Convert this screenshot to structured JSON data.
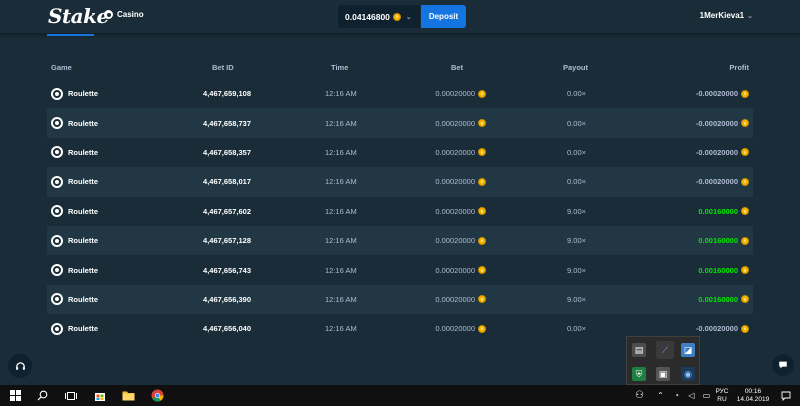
{
  "header": {
    "logo": "Stake",
    "nav_casino": "Casino",
    "balance": "0.04146800",
    "deposit_label": "Deposit",
    "username": "1MerKieva1"
  },
  "table": {
    "headers": {
      "game": "Game",
      "bet_id": "Bet ID",
      "time": "Time",
      "bet": "Bet",
      "payout": "Payout",
      "profit": "Profit"
    },
    "rows": [
      {
        "game": "Roulette",
        "bet_id": "4,467,659,108",
        "time": "12:16 AM",
        "bet": "0.00020000",
        "payout": "0.00×",
        "profit": "-0.00020000",
        "win": false
      },
      {
        "game": "Roulette",
        "bet_id": "4,467,658,737",
        "time": "12:16 AM",
        "bet": "0.00020000",
        "payout": "0.00×",
        "profit": "-0.00020000",
        "win": false
      },
      {
        "game": "Roulette",
        "bet_id": "4,467,658,357",
        "time": "12:16 AM",
        "bet": "0.00020000",
        "payout": "0.00×",
        "profit": "-0.00020000",
        "win": false
      },
      {
        "game": "Roulette",
        "bet_id": "4,467,658,017",
        "time": "12:16 AM",
        "bet": "0.00020000",
        "payout": "0.00×",
        "profit": "-0.00020000",
        "win": false
      },
      {
        "game": "Roulette",
        "bet_id": "4,467,657,602",
        "time": "12:16 AM",
        "bet": "0.00020000",
        "payout": "9.00×",
        "profit": "0.00160000",
        "win": true
      },
      {
        "game": "Roulette",
        "bet_id": "4,467,657,128",
        "time": "12:16 AM",
        "bet": "0.00020000",
        "payout": "9.00×",
        "profit": "0.00160000",
        "win": true
      },
      {
        "game": "Roulette",
        "bet_id": "4,467,656,743",
        "time": "12:16 AM",
        "bet": "0.00020000",
        "payout": "9.00×",
        "profit": "0.00160000",
        "win": true
      },
      {
        "game": "Roulette",
        "bet_id": "4,467,656,390",
        "time": "12:16 AM",
        "bet": "0.00020000",
        "payout": "9.00×",
        "profit": "0.00160000",
        "win": true
      },
      {
        "game": "Roulette",
        "bet_id": "4,467,656,040",
        "time": "12:16 AM",
        "bet": "0.00020000",
        "payout": "0.00×",
        "profit": "-0.00020000",
        "win": false
      }
    ]
  },
  "taskbar": {
    "lang_top": "РУС",
    "lang_bottom": "RU",
    "time": "00:16",
    "date": "14.04.2019"
  },
  "colors": {
    "background": "#1a2c38",
    "row_alt": "#213743",
    "accent": "#1475e1",
    "win": "#00e701",
    "coin": "#f7b500"
  }
}
